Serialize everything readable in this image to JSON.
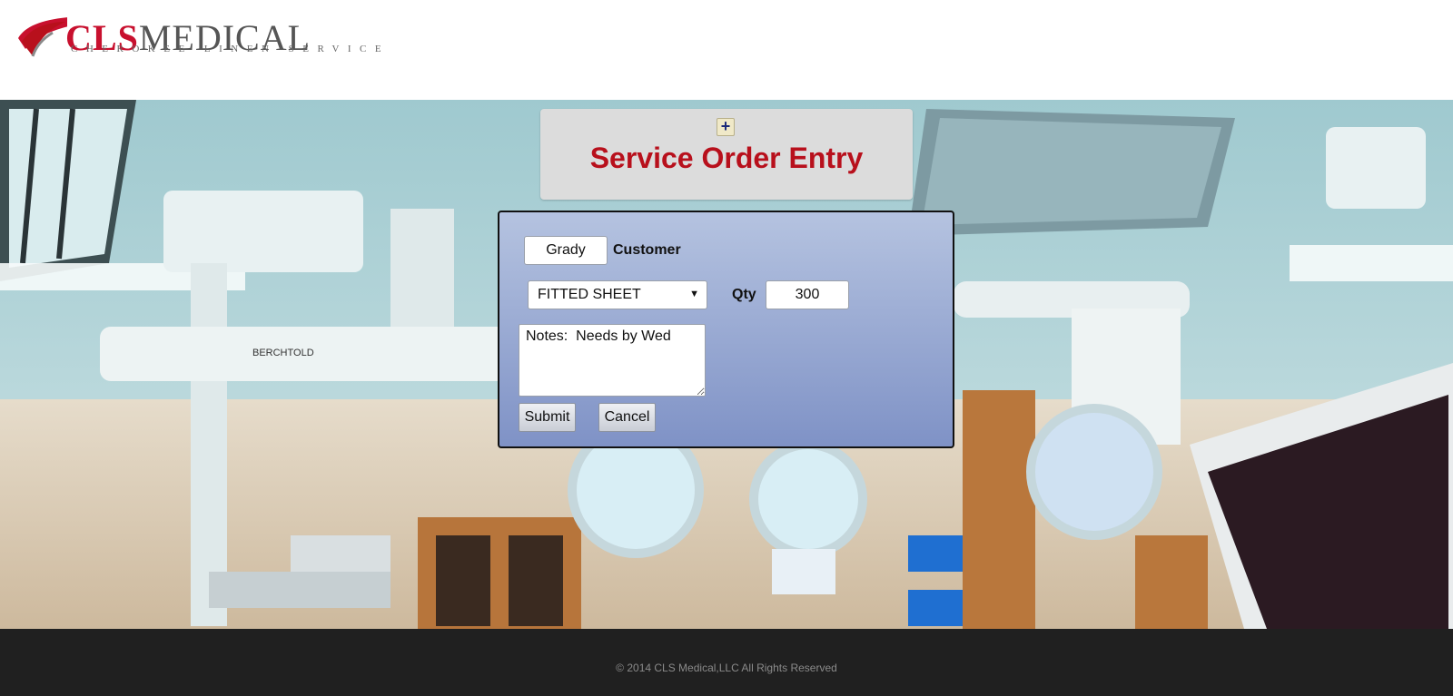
{
  "header": {
    "logo": {
      "brand_first": "CLS",
      "brand_second": "MEDICAL",
      "tagline": "CHEROKEE LINEN SERVICE"
    }
  },
  "title_box": {
    "toggle_icon": "plus-icon",
    "title": "Service Order Entry"
  },
  "form": {
    "customer_value": "Grady",
    "customer_label": "Customer",
    "item_selected": "FITTED SHEET",
    "qty_label": "Qty",
    "qty_value": "300",
    "notes_value": "Notes:  Needs by Wed",
    "submit_label": "Submit",
    "cancel_label": "Cancel"
  },
  "footer": {
    "copyright": "© 2014 CLS Medical,LLC All Rights Reserved"
  },
  "colors": {
    "brand_red": "#c8102e",
    "title_red": "#b8101c",
    "panel_top": "#b5c3e0",
    "panel_bottom": "#7f92c6",
    "footer_bg": "#202020"
  }
}
